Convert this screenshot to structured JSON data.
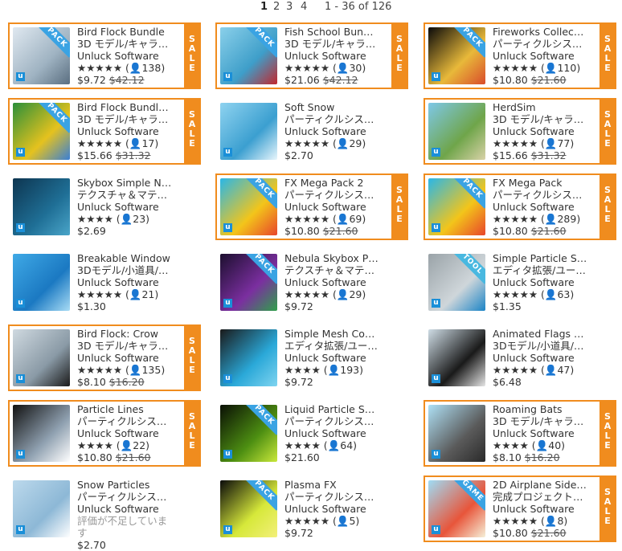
{
  "pagination": {
    "pages": [
      "1",
      "2",
      "3",
      "4"
    ],
    "active": "1",
    "range": "1 - 36 of 126"
  },
  "sale_label": [
    "S",
    "A",
    "L",
    "E"
  ],
  "items": [
    {
      "title": "Bird Flock Bundle",
      "category": "3D モデル/キャラ…",
      "publisher": "Unluck Software",
      "stars": "★★★★★",
      "count": "138",
      "price": "$9.72",
      "old_price": "$42.12",
      "sale": true,
      "badge": "PACK",
      "thumb": [
        "#dfe8f0",
        "#9fb3c2",
        "#5a6e80"
      ]
    },
    {
      "title": "Fish School Bun…",
      "category": "3D モデル/キャラ…",
      "publisher": "Unluck Software",
      "stars": "★★★★★",
      "count": "30",
      "price": "$21.06",
      "old_price": "$42.12",
      "sale": true,
      "badge": "PACK",
      "thumb": [
        "#8ad0ea",
        "#3e9ec9",
        "#c2272d"
      ]
    },
    {
      "title": "Fireworks Collec…",
      "category": "パーティクルシス…",
      "publisher": "Unluck Software",
      "stars": "★★★★★",
      "count": "110",
      "price": "$10.80",
      "old_price": "$21.60",
      "sale": true,
      "badge": "PACK",
      "thumb": [
        "#0a0a0a",
        "#e8b93a",
        "#d94b2b"
      ]
    },
    {
      "title": "Bird Flock Bundl…",
      "category": "3D モデル/キャラ…",
      "publisher": "Unluck Software",
      "stars": "★★★★★",
      "count": "17",
      "price": "$15.66",
      "old_price": "$31.32",
      "sale": true,
      "badge": "PACK",
      "thumb": [
        "#2a8f3a",
        "#e5c21e",
        "#3a7fd6"
      ]
    },
    {
      "title": "Soft Snow",
      "category": "パーティクルシス…",
      "publisher": "Unluck Software",
      "stars": "★★★★★",
      "count": "29",
      "price": "$2.70",
      "old_price": "",
      "sale": false,
      "badge": "",
      "thumb": [
        "#8fd3f0",
        "#3b9fd0",
        "#e8f6fc"
      ]
    },
    {
      "title": "HerdSim",
      "category": "3D モデル/キャラ…",
      "publisher": "Unluck Software",
      "stars": "★★★★★",
      "count": "77",
      "price": "$15.66",
      "old_price": "$31.32",
      "sale": true,
      "badge": "",
      "thumb": [
        "#7ec8e8",
        "#6fa54a",
        "#d9d2a8"
      ]
    },
    {
      "title": "Skybox Simple N…",
      "category": "テクスチャ＆マテ…",
      "publisher": "Unluck Software",
      "stars": "★★★★",
      "count": "23",
      "price": "$2.69",
      "old_price": "",
      "sale": false,
      "badge": "",
      "thumb": [
        "#0d3550",
        "#1f6f96",
        "#4aa5c9"
      ]
    },
    {
      "title": "FX Mega Pack 2",
      "category": "パーティクルシス…",
      "publisher": "Unluck Software",
      "stars": "★★★★★",
      "count": "69",
      "price": "$10.80",
      "old_price": "$21.60",
      "sale": true,
      "badge": "PACK",
      "thumb": [
        "#2ab7e8",
        "#f3c51a",
        "#e8452b"
      ]
    },
    {
      "title": "FX Mega Pack",
      "category": "パーティクルシス…",
      "publisher": "Unluck Software",
      "stars": "★★★★★",
      "count": "289",
      "price": "$10.80",
      "old_price": "$21.60",
      "sale": true,
      "badge": "PACK",
      "thumb": [
        "#2ab7e8",
        "#f3c51a",
        "#e8452b"
      ]
    },
    {
      "title": "Breakable Window",
      "category": "3Dモデル/小道具/…",
      "publisher": "Unluck Software",
      "stars": "★★★★★",
      "count": "21",
      "price": "$1.30",
      "old_price": "",
      "sale": false,
      "badge": "",
      "thumb": [
        "#3fa9e6",
        "#1b79c2",
        "#a8dcf5"
      ]
    },
    {
      "title": "Nebula Skybox P…",
      "category": "テクスチャ＆マテ…",
      "publisher": "Unluck Software",
      "stars": "★★★★★",
      "count": "29",
      "price": "$9.72",
      "old_price": "",
      "sale": false,
      "badge": "PACK",
      "thumb": [
        "#1c0f2e",
        "#7b2fa0",
        "#2fa04a"
      ]
    },
    {
      "title": "Simple Particle S…",
      "category": "エディタ拡張/ユー…",
      "publisher": "Unluck Software",
      "stars": "★★★★★",
      "count": "63",
      "price": "$1.35",
      "old_price": "",
      "sale": false,
      "badge": "TOOL",
      "thumb": [
        "#9aa3a8",
        "#cfd6da",
        "#1b84c6"
      ]
    },
    {
      "title": "Bird Flock: Crow",
      "category": "3D モデル/キャラ…",
      "publisher": "Unluck Software",
      "stars": "★★★★★",
      "count": "135",
      "price": "$8.10",
      "old_price": "$16.20",
      "sale": true,
      "badge": "",
      "thumb": [
        "#cfd9e0",
        "#8a9aa6",
        "#1a1a1a"
      ]
    },
    {
      "title": "Simple Mesh Co…",
      "category": "エディタ拡張/ユー…",
      "publisher": "Unluck Software",
      "stars": "★★★★",
      "count": "193",
      "price": "$9.72",
      "old_price": "",
      "sale": false,
      "badge": "",
      "thumb": [
        "#1a1a1a",
        "#2aa8d8",
        "#7fd4f0"
      ]
    },
    {
      "title": "Animated Flags …",
      "category": "3Dモデル/小道具/…",
      "publisher": "Unluck Software",
      "stars": "★★★★★",
      "count": "47",
      "price": "$6.48",
      "old_price": "",
      "sale": false,
      "badge": "",
      "thumb": [
        "#cfdde6",
        "#1a1a1a",
        "#e6e6e6"
      ]
    },
    {
      "title": "Particle Lines",
      "category": "パーティクルシス…",
      "publisher": "Unluck Software",
      "stars": "★★★★",
      "count": "22",
      "price": "$10.80",
      "old_price": "$21.60",
      "sale": true,
      "badge": "",
      "thumb": [
        "#111111",
        "#8fa0b0",
        "#ffffff"
      ]
    },
    {
      "title": "Liquid Particle S…",
      "category": "パーティクルシス…",
      "publisher": "Unluck Software",
      "stars": "★★★★",
      "count": "64",
      "price": "$21.60",
      "old_price": "",
      "sale": false,
      "badge": "PACK",
      "thumb": [
        "#0a0f05",
        "#4d8f12",
        "#c9e83a"
      ]
    },
    {
      "title": "Roaming Bats",
      "category": "3D モデル/キャラ…",
      "publisher": "Unluck Software",
      "stars": "★★★★",
      "count": "40",
      "price": "$8.10",
      "old_price": "$16.20",
      "sale": true,
      "badge": "",
      "thumb": [
        "#aee0f5",
        "#5a5a5a",
        "#2a2a2a"
      ]
    },
    {
      "title": "Snow Particles",
      "category": "パーティクルシス…",
      "publisher": "Unluck Software",
      "stars": "",
      "count": "",
      "rating_text": "評価が不足していま",
      "rating_text2": "す",
      "price": "$2.70",
      "old_price": "",
      "sale": false,
      "badge": "",
      "thumb": [
        "#bcd9ec",
        "#8db8d6",
        "#ffffff"
      ]
    },
    {
      "title": "Plasma FX",
      "category": "パーティクルシス…",
      "publisher": "Unluck Software",
      "stars": "★★★★★",
      "count": "5",
      "price": "$9.72",
      "old_price": "",
      "sale": false,
      "badge": "PACK",
      "thumb": [
        "#0a0a0a",
        "#d6e83a",
        "#f3f07a"
      ]
    },
    {
      "title": "2D Airplane Side…",
      "category": "完成プロジェクト…",
      "publisher": "Unluck Software",
      "stars": "★★★★★",
      "count": "8",
      "price": "$10.80",
      "old_price": "$21.60",
      "sale": true,
      "badge": "GAME",
      "thumb": [
        "#9fdcf5",
        "#e8553a",
        "#f6f0d8"
      ]
    }
  ]
}
